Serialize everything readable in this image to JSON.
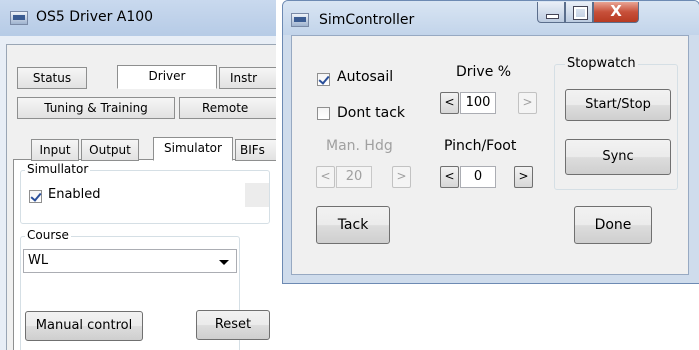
{
  "left_window": {
    "title": "OS5 Driver A100",
    "tabs_row1": [
      "Status",
      "Driver",
      "Instr"
    ],
    "tabs_row2": [
      "Tuning & Training",
      "Remote"
    ],
    "tabs_row3": [
      "Input",
      "Output",
      "Simulator",
      "BIFs"
    ],
    "simulator_group": "Simullator",
    "enabled_label": "Enabled",
    "enabled_checked": true,
    "course_group": "Course",
    "course_value": "WL",
    "manual_control_label": "Manual control",
    "reset_label": "Reset"
  },
  "sim_controller": {
    "title": "SimController",
    "close_glyph": "X",
    "autosail_label": "Autosail",
    "autosail_checked": true,
    "dont_tack_label": "Dont tack",
    "dont_tack_checked": false,
    "drive_label": "Drive %",
    "drive_value": "100",
    "man_hdg_label": "Man. Hdg",
    "man_hdg_value": "20",
    "pinch_label": "Pinch/Foot",
    "pinch_value": "0",
    "dec_glyph": "<",
    "inc_glyph": ">",
    "stopwatch_label": "Stopwatch",
    "start_stop_label": "Start/Stop",
    "sync_label": "Sync",
    "tack_label": "Tack",
    "done_label": "Done"
  }
}
